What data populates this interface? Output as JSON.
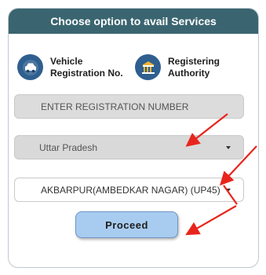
{
  "header": {
    "title": "Choose option to avail Services"
  },
  "options": [
    {
      "line1": "Vehicle",
      "line2": "Registration No.",
      "icon": "car-icon"
    },
    {
      "line1": "Registering",
      "line2": "Authority",
      "icon": "building-icon"
    }
  ],
  "registration_input": {
    "placeholder": "ENTER REGISTRATION NUMBER"
  },
  "state_select": {
    "value": "Uttar Pradesh"
  },
  "rto_select": {
    "value": "AKBARPUR(AMBEDKAR NAGAR) (UP45)"
  },
  "proceed_button": {
    "label": "Proceed"
  },
  "colors": {
    "header": "#3a6570",
    "button": "#a8ccf0",
    "arrow": "#e8251c",
    "icon_badge": "#2e5f8f"
  }
}
